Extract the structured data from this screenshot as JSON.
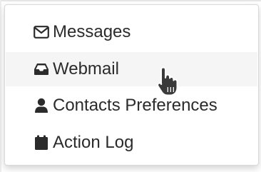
{
  "menu": {
    "items": [
      {
        "label": "Messages",
        "icon": "envelope-icon"
      },
      {
        "label": "Webmail",
        "icon": "inbox-tray-icon"
      },
      {
        "label": "Contacts Preferences",
        "icon": "user-icon"
      },
      {
        "label": "Action Log",
        "icon": "calendar-icon"
      }
    ],
    "active_index": 1
  },
  "colors": {
    "text": "#2b2b2b",
    "hover_background": "#f5f5f5",
    "border": "#d9d9d9"
  },
  "cursor": {
    "icon": "hand-pointer-icon"
  }
}
